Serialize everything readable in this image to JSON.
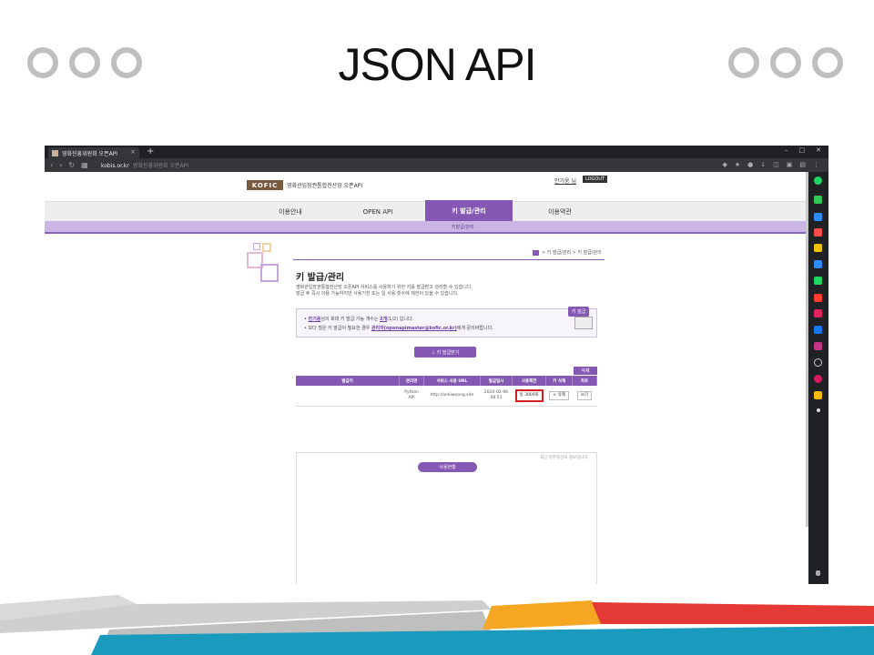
{
  "slide": {
    "title": "JSON API"
  },
  "browser": {
    "tab_title": "영화진흥위원회 오픈API",
    "tab_close": "×",
    "new_tab": "+",
    "window_controls": [
      "–",
      "□",
      "✕"
    ],
    "url_host": "kobis.or.kr",
    "url_rest": "영화진흥위원회 오픈API"
  },
  "site": {
    "logo_mark": "KOFIC",
    "logo_text": "영화관입장권통합전산망 오픈API",
    "user_link": "안기웅 님",
    "logout_label": "LOGOUT",
    "nav": [
      {
        "label": "이용안내",
        "active": false
      },
      {
        "label": "OPEN API",
        "active": false
      },
      {
        "label": "키 발급/관리",
        "active": true
      },
      {
        "label": "이용약관",
        "active": false
      }
    ],
    "subnav_label": "키발급/관리"
  },
  "content": {
    "breadcrumb": "> 키 발급/관리 > 키 발급/관리",
    "heading": "키 발급/관리",
    "description_lines": [
      "영화관입장권통합전산망 오픈API 서비스를 사용하기 위한 키를 발급받고 관리할 수 있습니다.",
      "발급 후 즉시 이용 가능하지만 사용기한 또는 일 사용 횟수에 제한이 있을 수 있습니다."
    ],
    "info": {
      "line1_prefix": "• ",
      "line1_name": "안기웅",
      "line1_mid": "님의 회대 키 발급 가능 개수는 ",
      "line1_count": "2개",
      "line1_suffix": "(1/2) 입니다.",
      "line2_prefix": "• 보다 많은 키 발급이 필요한 경우 ",
      "line2_contact": "관리자(openapimaster@kofic.or.kr)",
      "line2_suffix": "에게 문의바랍니다.",
      "badge": "키 발급"
    },
    "issue_button": "⊥ 키 발급받기",
    "delete_selected_button": "삭제",
    "table": {
      "headers": [
        "발급키",
        "관리명",
        "서비스 사용 URL",
        "발급일시",
        "사용제한",
        "키 삭제",
        "차트"
      ],
      "rows": [
        {
          "key": "",
          "name_line1": "Python",
          "name_line2": "API",
          "url": "http://ankiwoong.site",
          "date_line1": "2020-02-06",
          "date_line2": "08:51",
          "limit": "일 3000회",
          "delete": "× 삭제",
          "chart": "보기"
        }
      ]
    },
    "chart_note": "최근 일주일간의 정보입니다.",
    "usage_tab": "사용현황"
  }
}
